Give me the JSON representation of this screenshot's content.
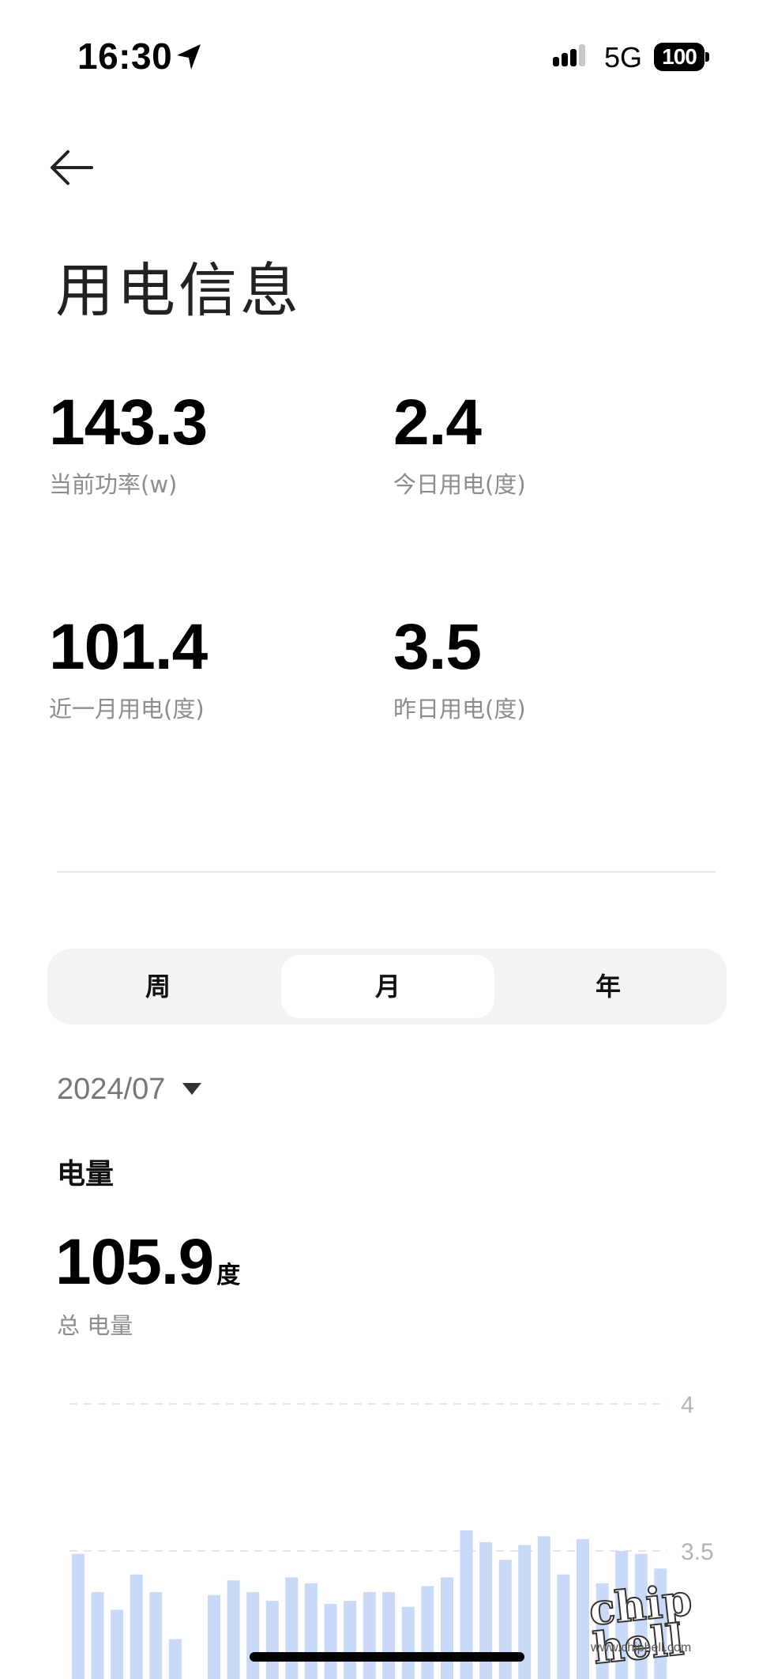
{
  "status_bar": {
    "time": "16:30",
    "network": "5G",
    "battery": "100"
  },
  "header": {
    "title": "用电信息"
  },
  "stats": {
    "current_power": {
      "value": "143.3",
      "label": "当前功率(w)"
    },
    "today": {
      "value": "2.4",
      "label": "今日用电(度)"
    },
    "recent_month": {
      "value": "101.4",
      "label": "近一月用电(度)"
    },
    "yesterday": {
      "value": "3.5",
      "label": "昨日用电(度)"
    }
  },
  "tabs": [
    {
      "label": "周",
      "selected": false
    },
    {
      "label": "月",
      "selected": true
    },
    {
      "label": "年",
      "selected": false
    }
  ],
  "period": {
    "value": "2024/07"
  },
  "energy": {
    "heading": "电量",
    "total_value": "105.9",
    "total_unit": "度",
    "total_label": "总 电量"
  },
  "chart_data": {
    "type": "bar",
    "title": "",
    "xlabel": "",
    "ylabel": "",
    "ylim_visible": [
      3.1,
      4
    ],
    "y_ticks": [
      4,
      3.5
    ],
    "grid": true,
    "bar_color": "#c9daf8",
    "values": [
      3.49,
      3.36,
      3.3,
      3.42,
      3.36,
      3.2,
      null,
      3.35,
      3.4,
      3.36,
      3.33,
      3.41,
      3.39,
      3.32,
      3.33,
      3.36,
      3.36,
      3.31,
      3.38,
      3.41,
      3.57,
      3.53,
      3.47,
      3.52,
      3.55,
      3.42,
      3.54,
      3.39,
      3.5,
      3.49,
      3.44
    ]
  },
  "watermark": {
    "logo": "chip hell",
    "url": "www.chiphell.com"
  }
}
